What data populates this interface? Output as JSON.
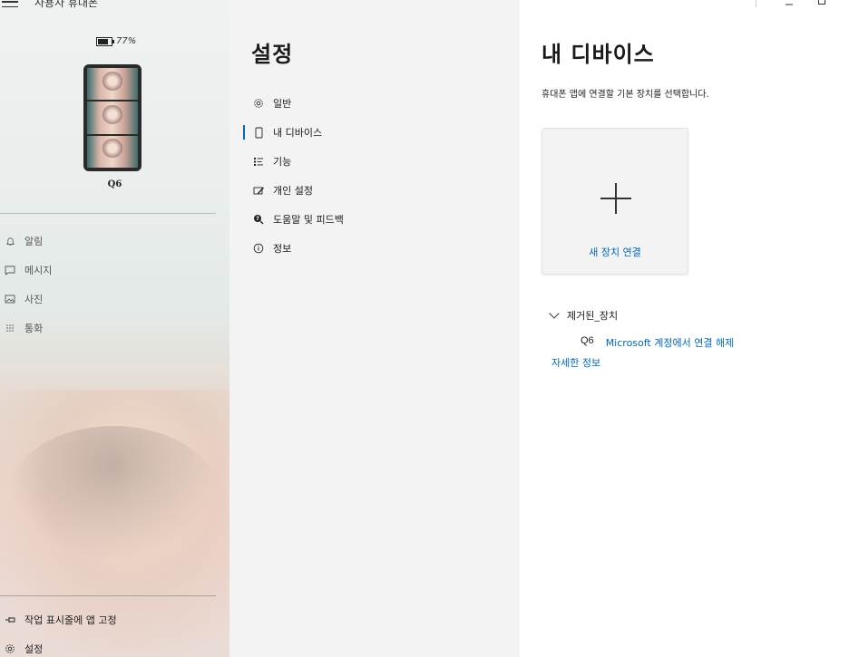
{
  "app": {
    "title": "사용자 휴대폰"
  },
  "sidebar": {
    "battery": "77%",
    "battery_level": 0.77,
    "device_name": "Q6",
    "nav": [
      {
        "label": "알림",
        "icon": "bell-icon"
      },
      {
        "label": "메시지",
        "icon": "message-icon"
      },
      {
        "label": "사진",
        "icon": "photo-icon"
      },
      {
        "label": "통화",
        "icon": "dialpad-icon"
      }
    ],
    "bottom": [
      {
        "label": "작업 표시줄에 앱 고정",
        "icon": "pin-icon"
      },
      {
        "label": "설정",
        "icon": "gear-icon"
      }
    ]
  },
  "settings": {
    "title": "설정",
    "nav": [
      {
        "label": "일반",
        "icon": "gear-icon"
      },
      {
        "label": "내 디바이스",
        "icon": "phone-icon"
      },
      {
        "label": "기능",
        "icon": "list-icon"
      },
      {
        "label": "개인 설정",
        "icon": "personalize-icon"
      },
      {
        "label": "도움말 및 피드백",
        "icon": "help-icon"
      },
      {
        "label": "정보",
        "icon": "info-icon"
      }
    ],
    "active_index": 1
  },
  "content": {
    "title": "내 디바이스",
    "description": "휴대폰 앱에 연결할 기본 장치를 선택합니다.",
    "add_device_label": "새 장치 연결",
    "removed_section_label": "제거된_장치",
    "removed_device_name": "Q6",
    "unlink_label": "Microsoft 계정에서 연결 해제",
    "more_info_label": "자세한 정보"
  },
  "colors": {
    "accent": "#0067c0",
    "pane_bg": "#f3f3f3",
    "content_bg": "#ffffff"
  }
}
